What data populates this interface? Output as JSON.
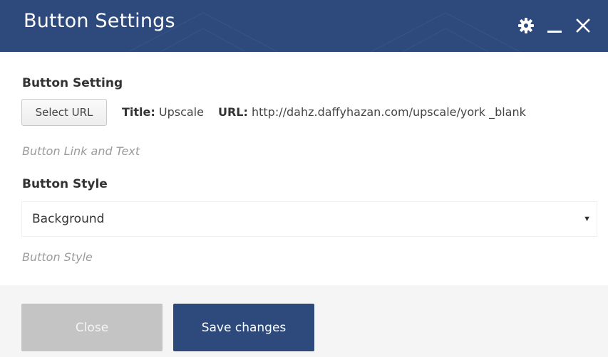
{
  "dialog": {
    "title": "Button Settings",
    "controls": {
      "settings_icon": "gear-icon",
      "minimize_icon": "minimize-icon",
      "close_icon": "close-icon"
    }
  },
  "button_setting": {
    "label": "Button Setting",
    "select_url_label": "Select URL",
    "title_label": "Title:",
    "title_value": "Upscale",
    "url_label": "URL:",
    "url_value": "http://dahz.daffyhazan.com/upscale/york",
    "target_value": "_blank",
    "help": "Button Link and Text"
  },
  "button_style": {
    "label": "Button Style",
    "selected": "Background",
    "help": "Button Style"
  },
  "footer": {
    "close_label": "Close",
    "save_label": "Save changes"
  },
  "colors": {
    "header": "#2e4a7d",
    "save_button": "#2e4a7d",
    "close_button": "#c4c4c4",
    "footer_bg": "#f5f5f5"
  }
}
